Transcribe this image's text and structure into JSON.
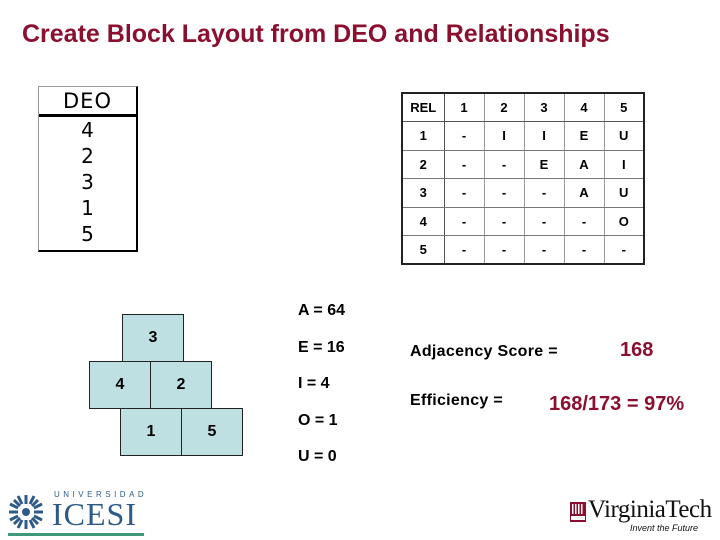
{
  "title": "Create Block Layout from DEO and Relationships",
  "deo": {
    "header": "DEO",
    "items": [
      "4",
      "2",
      "3",
      "1",
      "5"
    ]
  },
  "rel_table": {
    "header": [
      "REL",
      "1",
      "2",
      "3",
      "4",
      "5"
    ],
    "rows": [
      [
        "1",
        "-",
        "I",
        "I",
        "E",
        "U"
      ],
      [
        "2",
        "-",
        "-",
        "E",
        "A",
        "I"
      ],
      [
        "3",
        "-",
        "-",
        "-",
        "A",
        "U"
      ],
      [
        "4",
        "-",
        "-",
        "-",
        "-",
        "O"
      ],
      [
        "5",
        "-",
        "-",
        "-",
        "-",
        "-"
      ]
    ]
  },
  "block_layout": {
    "blocks": [
      {
        "label": "3",
        "row": 1,
        "col_offset": 1
      },
      {
        "label": "4",
        "row": 2,
        "col_offset": 0
      },
      {
        "label": "2",
        "row": 2,
        "col_offset": 1
      },
      {
        "label": "1",
        "row": 3,
        "col_offset": 0.5
      },
      {
        "label": "5",
        "row": 3,
        "col_offset": 1.5
      }
    ],
    "fill_color": "#bfe0e3"
  },
  "weights": [
    {
      "text": "A = 64"
    },
    {
      "text": "E = 16"
    },
    {
      "text": "I   = 4"
    },
    {
      "text": "O = 1"
    },
    {
      "text": "U = 0"
    }
  ],
  "results": {
    "adjacency_label": "Adjacency Score =",
    "adjacency_value": "168",
    "efficiency_label": "Efficiency  =",
    "efficiency_value": "168/173 = 97%"
  },
  "logos": {
    "left": {
      "small": "UNIVERSIDAD",
      "big": "ICESI"
    },
    "right": {
      "name": "VirginiaTech",
      "tagline": "Invent the Future"
    }
  },
  "colors": {
    "accent": "#8b0f2e",
    "block_fill": "#bfe0e3"
  }
}
